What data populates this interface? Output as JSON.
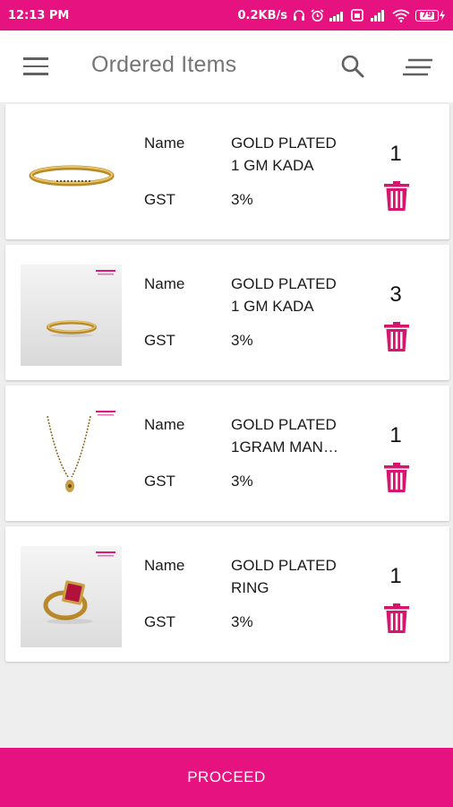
{
  "status_bar": {
    "time": "12:13 PM",
    "net_speed": "0.2KB/s",
    "battery": "79"
  },
  "app_bar": {
    "title": "Ordered Items"
  },
  "items": [
    {
      "name_label": "Name",
      "name": "GOLD PLATED 1 GM KADA",
      "gst_label": "GST",
      "gst": "3%",
      "qty": "1",
      "image": "gold-kada-image"
    },
    {
      "name_label": "Name",
      "name": "GOLD PLATED 1 GM KADA",
      "gst_label": "GST",
      "gst": "3%",
      "qty": "3",
      "image": "gold-kada-image"
    },
    {
      "name_label": "Name",
      "name": "GOLD PLATED 1GRAM MAN…",
      "gst_label": "GST",
      "gst": "3%",
      "qty": "1",
      "image": "mangalsutra-image"
    },
    {
      "name_label": "Name",
      "name": "GOLD PLATED RING",
      "gst_label": "GST",
      "gst": "3%",
      "qty": "1",
      "image": "ring-image"
    }
  ],
  "footer": {
    "proceed_label": "PROCEED"
  },
  "colors": {
    "accent": "#e5127f",
    "title_gray": "#757575"
  }
}
